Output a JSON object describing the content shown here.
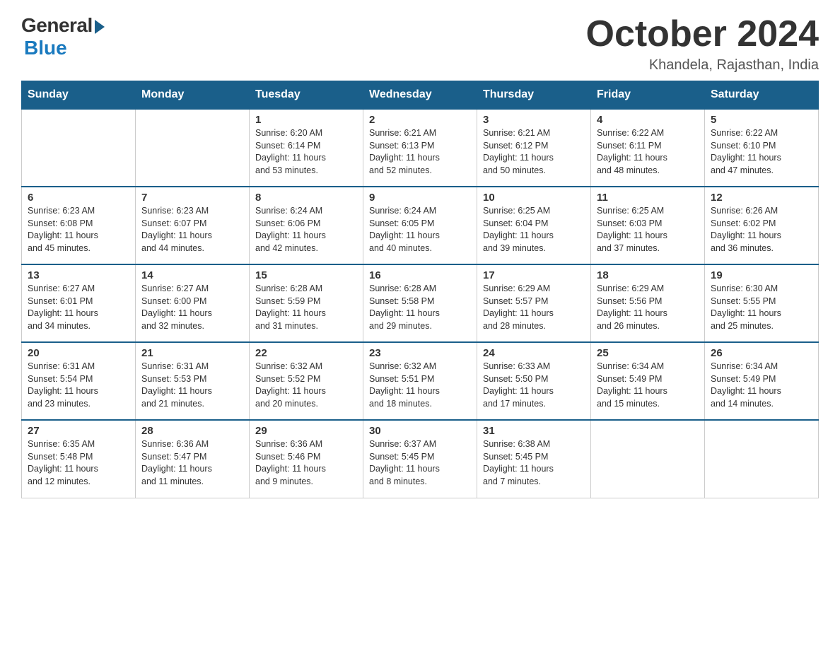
{
  "logo": {
    "general": "General",
    "blue": "Blue"
  },
  "title": "October 2024",
  "location": "Khandela, Rajasthan, India",
  "days_of_week": [
    "Sunday",
    "Monday",
    "Tuesday",
    "Wednesday",
    "Thursday",
    "Friday",
    "Saturday"
  ],
  "weeks": [
    [
      {
        "day": "",
        "info": ""
      },
      {
        "day": "",
        "info": ""
      },
      {
        "day": "1",
        "info": "Sunrise: 6:20 AM\nSunset: 6:14 PM\nDaylight: 11 hours\nand 53 minutes."
      },
      {
        "day": "2",
        "info": "Sunrise: 6:21 AM\nSunset: 6:13 PM\nDaylight: 11 hours\nand 52 minutes."
      },
      {
        "day": "3",
        "info": "Sunrise: 6:21 AM\nSunset: 6:12 PM\nDaylight: 11 hours\nand 50 minutes."
      },
      {
        "day": "4",
        "info": "Sunrise: 6:22 AM\nSunset: 6:11 PM\nDaylight: 11 hours\nand 48 minutes."
      },
      {
        "day": "5",
        "info": "Sunrise: 6:22 AM\nSunset: 6:10 PM\nDaylight: 11 hours\nand 47 minutes."
      }
    ],
    [
      {
        "day": "6",
        "info": "Sunrise: 6:23 AM\nSunset: 6:08 PM\nDaylight: 11 hours\nand 45 minutes."
      },
      {
        "day": "7",
        "info": "Sunrise: 6:23 AM\nSunset: 6:07 PM\nDaylight: 11 hours\nand 44 minutes."
      },
      {
        "day": "8",
        "info": "Sunrise: 6:24 AM\nSunset: 6:06 PM\nDaylight: 11 hours\nand 42 minutes."
      },
      {
        "day": "9",
        "info": "Sunrise: 6:24 AM\nSunset: 6:05 PM\nDaylight: 11 hours\nand 40 minutes."
      },
      {
        "day": "10",
        "info": "Sunrise: 6:25 AM\nSunset: 6:04 PM\nDaylight: 11 hours\nand 39 minutes."
      },
      {
        "day": "11",
        "info": "Sunrise: 6:25 AM\nSunset: 6:03 PM\nDaylight: 11 hours\nand 37 minutes."
      },
      {
        "day": "12",
        "info": "Sunrise: 6:26 AM\nSunset: 6:02 PM\nDaylight: 11 hours\nand 36 minutes."
      }
    ],
    [
      {
        "day": "13",
        "info": "Sunrise: 6:27 AM\nSunset: 6:01 PM\nDaylight: 11 hours\nand 34 minutes."
      },
      {
        "day": "14",
        "info": "Sunrise: 6:27 AM\nSunset: 6:00 PM\nDaylight: 11 hours\nand 32 minutes."
      },
      {
        "day": "15",
        "info": "Sunrise: 6:28 AM\nSunset: 5:59 PM\nDaylight: 11 hours\nand 31 minutes."
      },
      {
        "day": "16",
        "info": "Sunrise: 6:28 AM\nSunset: 5:58 PM\nDaylight: 11 hours\nand 29 minutes."
      },
      {
        "day": "17",
        "info": "Sunrise: 6:29 AM\nSunset: 5:57 PM\nDaylight: 11 hours\nand 28 minutes."
      },
      {
        "day": "18",
        "info": "Sunrise: 6:29 AM\nSunset: 5:56 PM\nDaylight: 11 hours\nand 26 minutes."
      },
      {
        "day": "19",
        "info": "Sunrise: 6:30 AM\nSunset: 5:55 PM\nDaylight: 11 hours\nand 25 minutes."
      }
    ],
    [
      {
        "day": "20",
        "info": "Sunrise: 6:31 AM\nSunset: 5:54 PM\nDaylight: 11 hours\nand 23 minutes."
      },
      {
        "day": "21",
        "info": "Sunrise: 6:31 AM\nSunset: 5:53 PM\nDaylight: 11 hours\nand 21 minutes."
      },
      {
        "day": "22",
        "info": "Sunrise: 6:32 AM\nSunset: 5:52 PM\nDaylight: 11 hours\nand 20 minutes."
      },
      {
        "day": "23",
        "info": "Sunrise: 6:32 AM\nSunset: 5:51 PM\nDaylight: 11 hours\nand 18 minutes."
      },
      {
        "day": "24",
        "info": "Sunrise: 6:33 AM\nSunset: 5:50 PM\nDaylight: 11 hours\nand 17 minutes."
      },
      {
        "day": "25",
        "info": "Sunrise: 6:34 AM\nSunset: 5:49 PM\nDaylight: 11 hours\nand 15 minutes."
      },
      {
        "day": "26",
        "info": "Sunrise: 6:34 AM\nSunset: 5:49 PM\nDaylight: 11 hours\nand 14 minutes."
      }
    ],
    [
      {
        "day": "27",
        "info": "Sunrise: 6:35 AM\nSunset: 5:48 PM\nDaylight: 11 hours\nand 12 minutes."
      },
      {
        "day": "28",
        "info": "Sunrise: 6:36 AM\nSunset: 5:47 PM\nDaylight: 11 hours\nand 11 minutes."
      },
      {
        "day": "29",
        "info": "Sunrise: 6:36 AM\nSunset: 5:46 PM\nDaylight: 11 hours\nand 9 minutes."
      },
      {
        "day": "30",
        "info": "Sunrise: 6:37 AM\nSunset: 5:45 PM\nDaylight: 11 hours\nand 8 minutes."
      },
      {
        "day": "31",
        "info": "Sunrise: 6:38 AM\nSunset: 5:45 PM\nDaylight: 11 hours\nand 7 minutes."
      },
      {
        "day": "",
        "info": ""
      },
      {
        "day": "",
        "info": ""
      }
    ]
  ]
}
